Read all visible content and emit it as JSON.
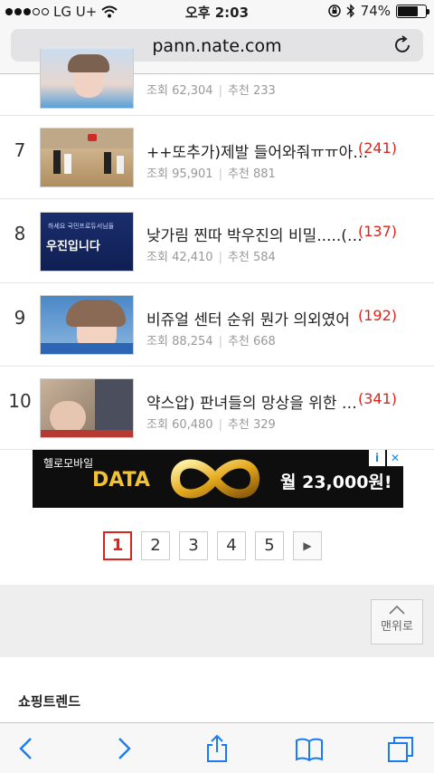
{
  "status": {
    "carrier": "LG U+",
    "time": "오후 2:03",
    "battery_text": "74%",
    "battery_level": 0.74
  },
  "browser": {
    "url": "pann.nate.com",
    "reload_icon": "reload-icon"
  },
  "list": {
    "items": [
      {
        "rank": "",
        "title": "",
        "count": "",
        "views_label": "조회",
        "views": "62,304",
        "rec_label": "추천",
        "recs": "233"
      },
      {
        "rank": "7",
        "title": "++또추가)제발 들어와줘ㅠㅠ아…",
        "count": "(241)",
        "views_label": "조회",
        "views": "95,901",
        "rec_label": "추천",
        "recs": "881"
      },
      {
        "rank": "8",
        "title": "낮가림 찐따 박우진의 비밀.....(…",
        "count": "(137)",
        "views_label": "조회",
        "views": "42,410",
        "rec_label": "추천",
        "recs": "584"
      },
      {
        "rank": "9",
        "title": "비쥬얼 센터 순위 뭔가 의외였어",
        "count": "(192)",
        "views_label": "조회",
        "views": "88,254",
        "rec_label": "추천",
        "recs": "668"
      },
      {
        "rank": "10",
        "title": "약스압) 판녀들의 망상을 위한 …",
        "count": "(341)",
        "views_label": "조회",
        "views": "60,480",
        "rec_label": "추천",
        "recs": "329"
      }
    ],
    "thumb_texts": {
      "t8_top": "하세요 국민프로듀서님들",
      "t8_main": "우진입니다"
    }
  },
  "ad": {
    "brand": "헬로모바일",
    "data": "DATA",
    "price": "월 23,000원!",
    "info_icon": "i",
    "close_icon": "✕"
  },
  "pager": {
    "pages": [
      "1",
      "2",
      "3",
      "4",
      "5"
    ],
    "current": "1",
    "next_icon": "▶"
  },
  "top_button": {
    "label": "맨위로"
  },
  "section": {
    "title": "쇼핑트렌드"
  },
  "toolbar": {
    "icons": [
      "back-icon",
      "forward-icon",
      "share-icon",
      "bookmarks-icon",
      "tabs-icon"
    ]
  },
  "colors": {
    "accent_red": "#d9251c",
    "meta_gray": "#999999"
  }
}
